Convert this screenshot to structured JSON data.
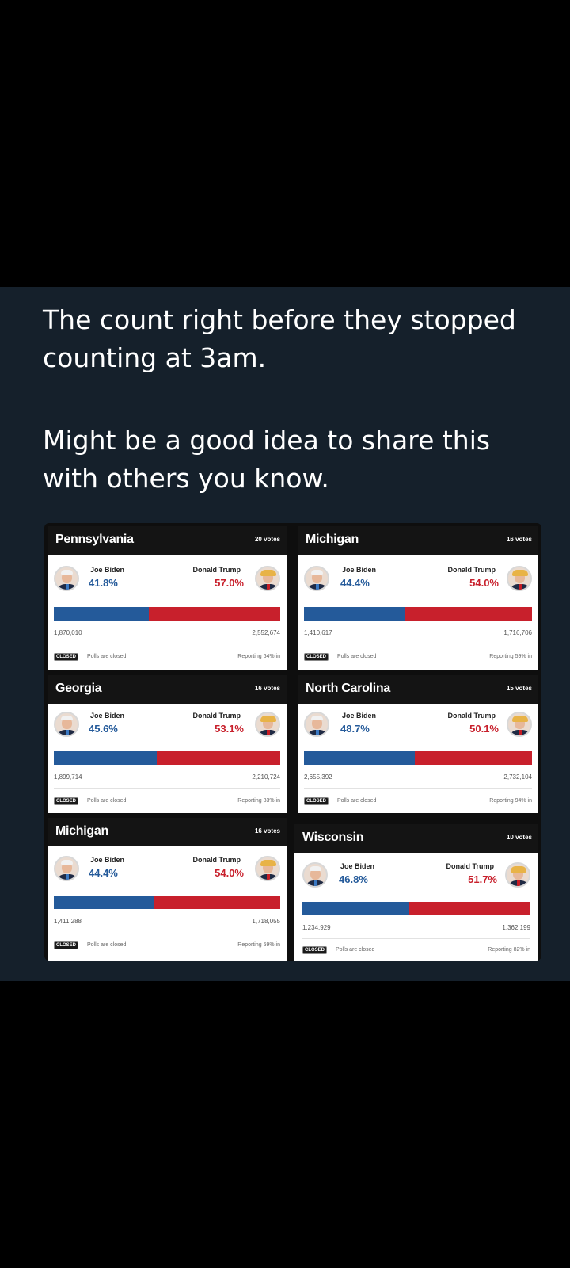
{
  "post": {
    "text": [
      "The count right before they stopped counting at 3am.",
      "Might be a good idea to share this with others you know."
    ]
  },
  "candidates": {
    "dem": "Joe Biden",
    "rep": "Donald Trump"
  },
  "status": {
    "badge": "CLOSED",
    "polls": "Polls are closed"
  },
  "colors": {
    "biden": "#245a9a",
    "trump": "#c8202c",
    "post_background": "#15202b"
  },
  "cards": [
    {
      "state": "Pennsylvania",
      "votes": "20 votes",
      "biden_pct": "41.8%",
      "trump_pct": "57.0%",
      "biden_votes": "1,870,010",
      "trump_votes": "2,552,674",
      "reporting": "Reporting 64% in",
      "biden_share": 0.418
    },
    {
      "state": "Michigan",
      "votes": "16 votes",
      "biden_pct": "44.4%",
      "trump_pct": "54.0%",
      "biden_votes": "1,410,617",
      "trump_votes": "1,716,706",
      "reporting": "Reporting 59% in",
      "biden_share": 0.444
    },
    {
      "state": "Georgia",
      "votes": "16 votes",
      "biden_pct": "45.6%",
      "trump_pct": "53.1%",
      "biden_votes": "1,899,714",
      "trump_votes": "2,210,724",
      "reporting": "Reporting 83% in",
      "biden_share": 0.456
    },
    {
      "state": "North Carolina",
      "votes": "15 votes",
      "biden_pct": "48.7%",
      "trump_pct": "50.1%",
      "biden_votes": "2,655,392",
      "trump_votes": "2,732,104",
      "reporting": "Reporting 94% in",
      "biden_share": 0.487
    },
    {
      "state": "Michigan",
      "votes": "16 votes",
      "biden_pct": "44.4%",
      "trump_pct": "54.0%",
      "biden_votes": "1,411,288",
      "trump_votes": "1,718,055",
      "reporting": "Reporting 59% in",
      "biden_share": 0.444
    },
    {
      "state": "Wisconsin",
      "votes": "10 votes",
      "biden_pct": "46.8%",
      "trump_pct": "51.7%",
      "biden_votes": "1,234,929",
      "trump_votes": "1,362,199",
      "reporting": "Reporting 82% in",
      "biden_share": 0.468
    }
  ]
}
